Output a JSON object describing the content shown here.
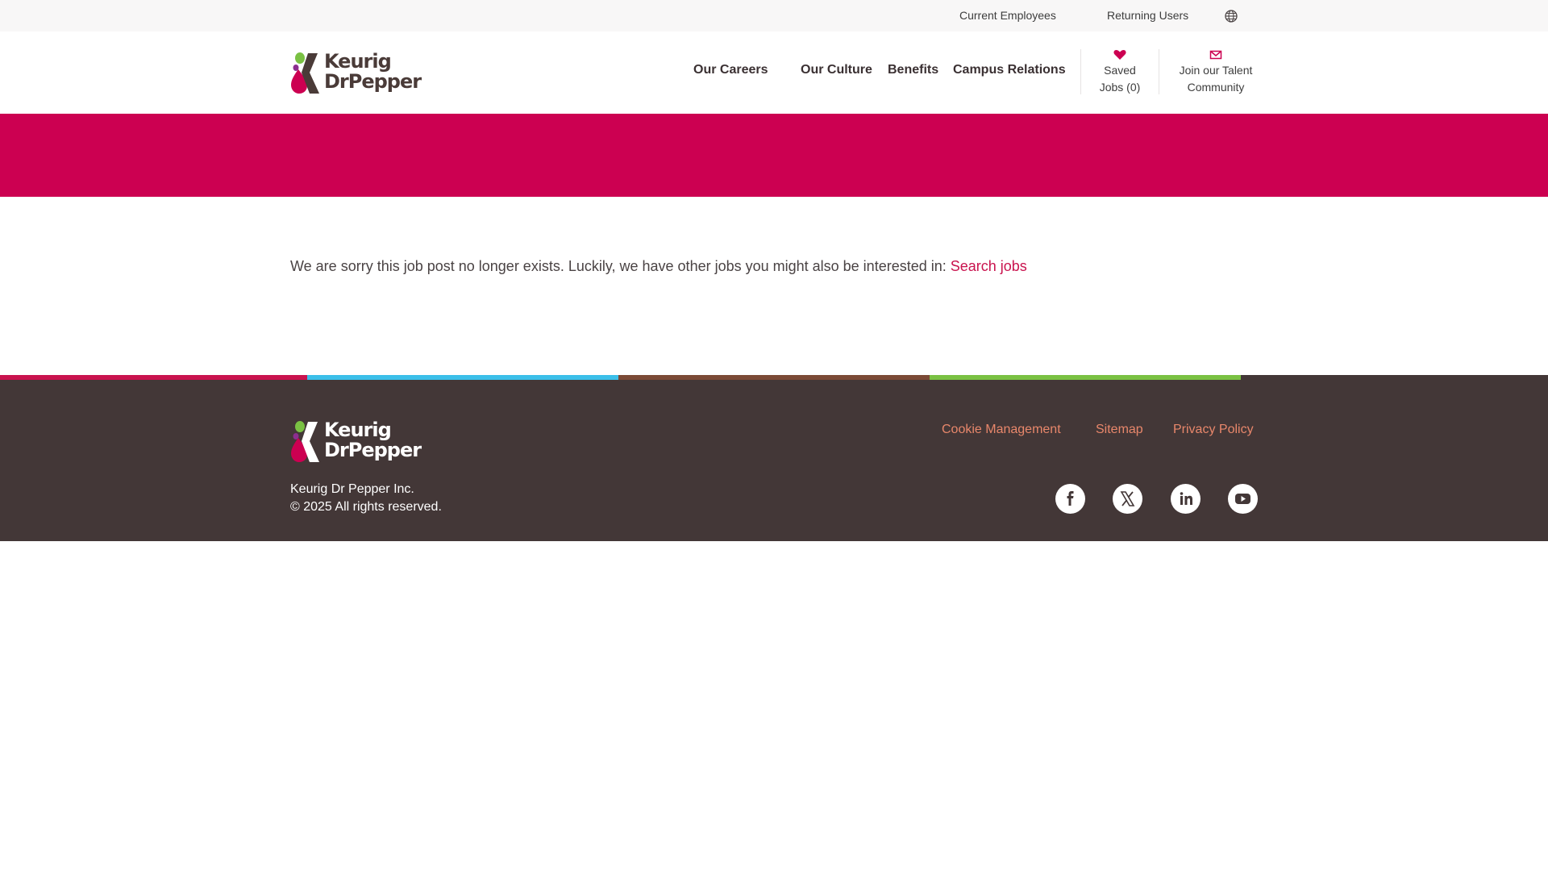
{
  "utility_bar": {
    "current_employees": "Current Employees",
    "returning_users": "Returning Users",
    "globe_icon": "globe-icon"
  },
  "header": {
    "logo": {
      "line1": "Keurig",
      "line2": "DrPepper"
    },
    "nav": {
      "our_careers": "Our Careers",
      "our_culture": "Our Culture",
      "benefits": "Benefits",
      "campus_relations": "Campus Relations"
    },
    "saved_jobs": {
      "line1": "Saved",
      "line2": "Jobs (0)",
      "icon": "heart-icon"
    },
    "talent_community": {
      "line1": "Join our Talent",
      "line2": "Community",
      "icon": "envelope-icon"
    }
  },
  "message": {
    "text": "We are sorry this job post no longer exists. Luckily, we have other jobs you might also be interested in: ",
    "link": "Search jobs"
  },
  "footer": {
    "logo": {
      "line1": "Keurig",
      "line2": "DrPepper"
    },
    "company_line1": "Keurig Dr Pepper Inc.",
    "company_line2": "© 2025 All rights reserved.",
    "links": {
      "cookie": "Cookie Management",
      "sitemap": "Sitemap",
      "privacy": "Privacy Policy"
    },
    "social_icons": [
      "facebook-icon",
      "x-twitter-icon",
      "linkedin-icon",
      "youtube-icon"
    ]
  },
  "colors": {
    "brand_magenta": "#cc0051",
    "footer_bg": "#433737",
    "stripe_pink": "#c9134e",
    "stripe_blue": "#3bbfe9",
    "stripe_brown": "#7b4a36",
    "stripe_green": "#7ac143",
    "link_magenta": "#c9134e",
    "footer_link": "#e8876b",
    "drop_green": "#7ac143",
    "drop_purple": "#8b2e8f",
    "drop_magenta": "#cc0051"
  }
}
